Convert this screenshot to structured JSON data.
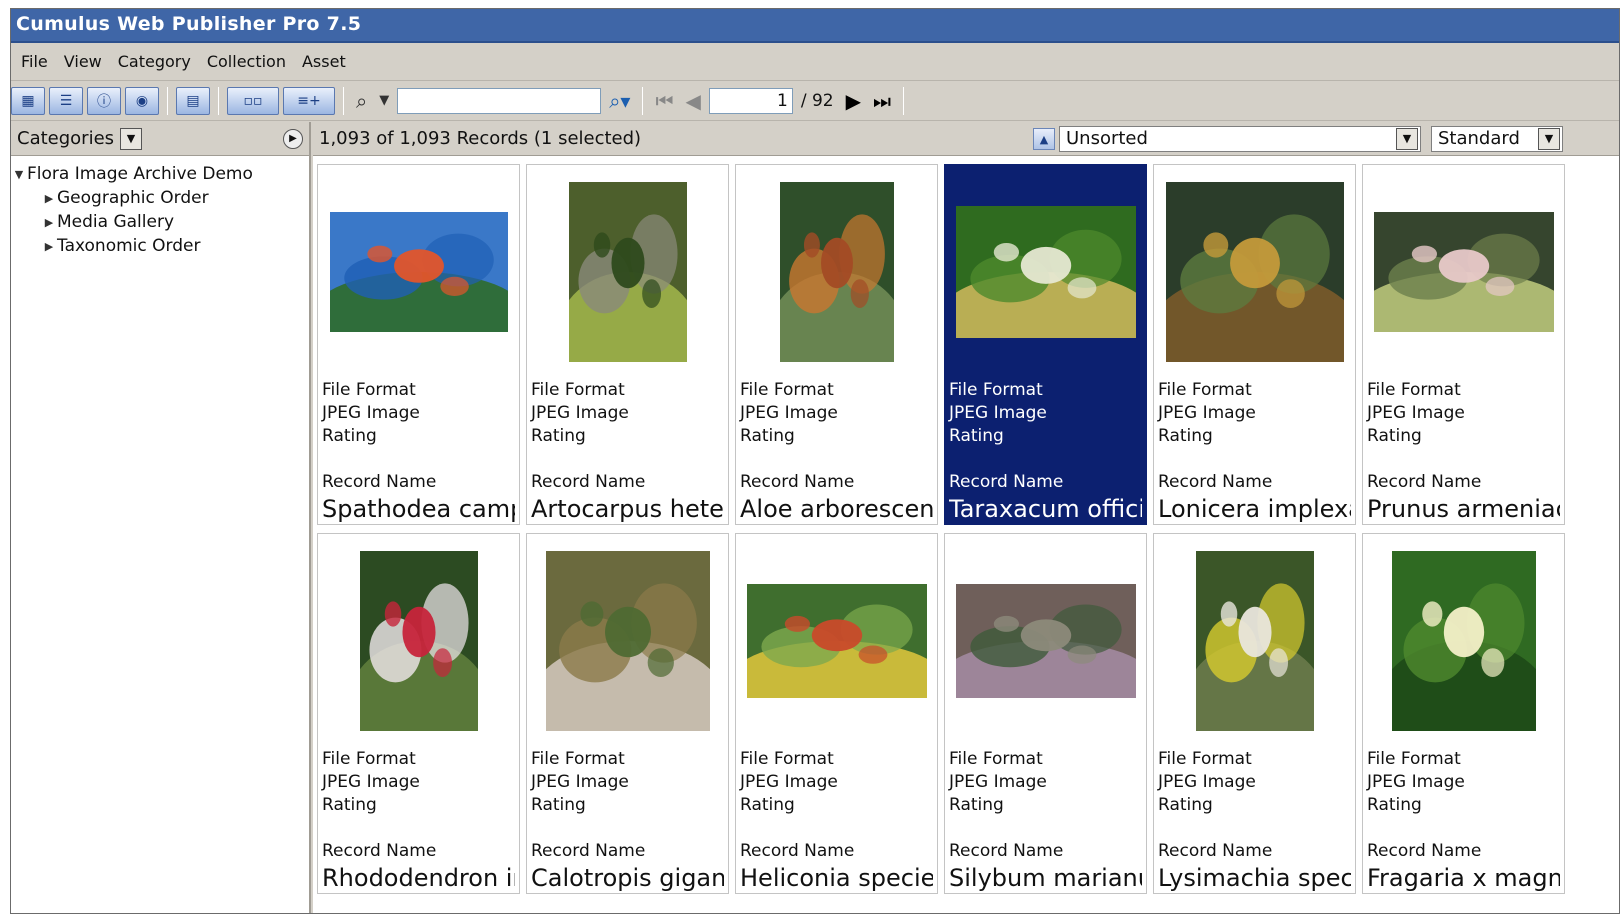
{
  "window": {
    "title": "Cumulus Web Publisher Pro 7.5"
  },
  "menu": [
    "File",
    "View",
    "Category",
    "Collection",
    "Asset"
  ],
  "toolbar": {
    "search_value": "",
    "page_current": "1",
    "page_total": "/ 92"
  },
  "left": {
    "selector_label": "Categories",
    "tree_root": "Flora Image Archive Demo",
    "tree_children": [
      "Geographic Order",
      "Media Gallery",
      "Taxonomic Order"
    ]
  },
  "right": {
    "record_count": "1,093 of 1,093 Records (1 selected)",
    "sort_value": "Unsorted",
    "view_value": "Standard"
  },
  "field_labels": {
    "file_format": "File Format",
    "rating": "Rating",
    "record_name": "Record Name"
  },
  "records": [
    {
      "format": "JPEG Image",
      "name": "Spathodea campanulata",
      "selected": false
    },
    {
      "format": "JPEG Image",
      "name": "Artocarpus heterophyllus",
      "selected": false
    },
    {
      "format": "JPEG Image",
      "name": "Aloe arborescens",
      "selected": false
    },
    {
      "format": "JPEG Image",
      "name": "Taraxacum officinale",
      "selected": true
    },
    {
      "format": "JPEG Image",
      "name": "Lonicera implexa",
      "selected": false
    },
    {
      "format": "JPEG Image",
      "name": "Prunus armeniaca",
      "selected": false
    },
    {
      "format": "JPEG Image",
      "name": "Rhododendron indicum",
      "selected": false
    },
    {
      "format": "JPEG Image",
      "name": "Calotropis gigantea",
      "selected": false
    },
    {
      "format": "JPEG Image",
      "name": "Heliconia species",
      "selected": false
    },
    {
      "format": "JPEG Image",
      "name": "Silybum marianum",
      "selected": false
    },
    {
      "format": "JPEG Image",
      "name": "Lysimachia species",
      "selected": false
    },
    {
      "format": "JPEG Image",
      "name": "Fragaria x magna",
      "selected": false
    }
  ],
  "thumbnails": [
    {
      "icon": "orange-flower-sky-photo",
      "colors": [
        "#3a78c8",
        "#1f5fb5",
        "#e2552b",
        "#2f6b2a"
      ]
    },
    {
      "icon": "tree-trunk-fruit-photo",
      "colors": [
        "#4d5f2c",
        "#8a8a7a",
        "#2e4a1c",
        "#9fb24a"
      ]
    },
    {
      "icon": "aloe-flower-spike-photo",
      "colors": [
        "#2f4f2a",
        "#c9772f",
        "#a34b25",
        "#6f8a54"
      ]
    },
    {
      "icon": "dandelion-seedhead-photo",
      "colors": [
        "#2f6b1f",
        "#4e8a2c",
        "#e6e8d2",
        "#c9b65a"
      ]
    },
    {
      "icon": "green-flower-bud-photo",
      "colors": [
        "#2b3d2a",
        "#5d7a3e",
        "#c49a3a",
        "#7a5a2a"
      ]
    },
    {
      "icon": "butterfly-blossom-photo",
      "colors": [
        "#36452e",
        "#6d7f4c",
        "#e8c9c9",
        "#b9c47a"
      ]
    },
    {
      "icon": "white-azalea-photo",
      "colors": [
        "#2c4b22",
        "#f1e8ee",
        "#c7243b",
        "#5e7d3c"
      ]
    },
    {
      "icon": "dry-undergrowth-photo",
      "colors": [
        "#6b6a3e",
        "#8b7a4a",
        "#4f6a33",
        "#cfc4b8"
      ]
    },
    {
      "icon": "heliconia-bloom-photo",
      "colors": [
        "#3f6e2e",
        "#7ea94d",
        "#c94a2a",
        "#d8c23c"
      ]
    },
    {
      "icon": "thistle-bud-photo",
      "colors": [
        "#6f5f5a",
        "#3f5a3a",
        "#8c8a7a",
        "#a28aa0"
      ]
    },
    {
      "icon": "yellow-loosestrife-photo",
      "colors": [
        "#3b5628",
        "#d7cc2e",
        "#e9e6dc",
        "#6a7a4a"
      ]
    },
    {
      "icon": "strawberry-plant-photo",
      "colors": [
        "#2f6a22",
        "#4f8a2e",
        "#f4f0c8",
        "#1e4a17"
      ]
    }
  ]
}
